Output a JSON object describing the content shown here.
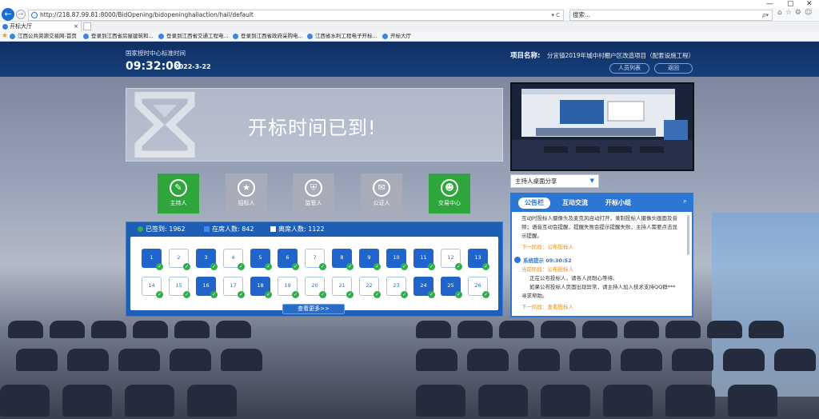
{
  "browser": {
    "url": "http://218.87.99.81:8000/BidOpening/bidopeninghallaction/hall/default",
    "url_controls": "▾ C",
    "search_placeholder": "搜索...",
    "search_controls": "ρ▾",
    "tab_title": "开标大厅",
    "tab_close": "×",
    "window_controls": [
      "—",
      "▢",
      "✕"
    ],
    "toolbar_icons": "⌂☆⚙☺"
  },
  "favorites": [
    "江西公共资源交易网-首页",
    "登录到江西省房屋建筑和...",
    "登录到江西省交通工程电...",
    "登录到江西省政府采购电...",
    "江西省水利工程电子开标...",
    "开标大厅"
  ],
  "header": {
    "time_label": "国家授时中心标准时间",
    "time": "09:32:00",
    "date": "2022-3-22",
    "project_label": "项目名称:",
    "project_name": "分宜镇2019年城中村棚户区改造项目（配套设施工程）",
    "btn_staff": "人员列表",
    "btn_back": "返回"
  },
  "banner": {
    "text": "开标时间已到!"
  },
  "roles": [
    {
      "label": "主持人",
      "icon": "✎",
      "color": "#2fa63c"
    },
    {
      "label": "招标人",
      "icon": "★",
      "color": "#a7acb8"
    },
    {
      "label": "监管人",
      "icon": "⛨",
      "color": "#a7acb8"
    },
    {
      "label": "公证人",
      "icon": "✉",
      "color": "#a7acb8"
    },
    {
      "label": "交易中心",
      "icon": "☻",
      "color": "#2fa63c"
    }
  ],
  "stats": {
    "signed": "已签到: 1962",
    "online": "在席人数: 842",
    "offline": "离席人数: 1122"
  },
  "seats_row1": [
    {
      "n": "1",
      "on": true
    },
    {
      "n": "2",
      "on": false
    },
    {
      "n": "3",
      "on": true
    },
    {
      "n": "4",
      "on": false
    },
    {
      "n": "5",
      "on": true
    },
    {
      "n": "6",
      "on": true
    },
    {
      "n": "7",
      "on": false
    },
    {
      "n": "8",
      "on": true
    },
    {
      "n": "9",
      "on": true
    },
    {
      "n": "10",
      "on": true
    },
    {
      "n": "11",
      "on": true
    },
    {
      "n": "12",
      "on": false
    },
    {
      "n": "13",
      "on": true
    }
  ],
  "seats_row2": [
    {
      "n": "14",
      "on": false
    },
    {
      "n": "15",
      "on": false
    },
    {
      "n": "16",
      "on": true
    },
    {
      "n": "17",
      "on": false
    },
    {
      "n": "18",
      "on": true
    },
    {
      "n": "19",
      "on": false
    },
    {
      "n": "20",
      "on": false
    },
    {
      "n": "21",
      "on": false
    },
    {
      "n": "22",
      "on": false
    },
    {
      "n": "23",
      "on": false
    },
    {
      "n": "24",
      "on": true
    },
    {
      "n": "25",
      "on": true
    },
    {
      "n": "26",
      "on": false
    }
  ],
  "more_button": "查看更多>>",
  "share_dropdown": "主持人桌面分享",
  "notice": {
    "tabs": [
      "公告栏",
      "互动交流",
      "开标小组"
    ],
    "lines1": [
      "互动时投标人摄像头及麦克风自动打开，录制投标人摄像头画面及音",
      "频；语音互动会提醒，提醒失败会提示提醒失败，主持人需要点击显",
      "示提醒。"
    ],
    "stage1": "下一阶段：公布投标人",
    "sys_title": "系统提示 09:30:52",
    "stage_current": "当前阶段：公布投标人",
    "lines2": [
      "正在公布投标人，请各人员耐心等待。",
      "如果公布投标人页面出现异常，请主持人加入技术支持QQ群***",
      "寻求帮助。"
    ],
    "stage2": "下一阶段：查看投标人"
  }
}
